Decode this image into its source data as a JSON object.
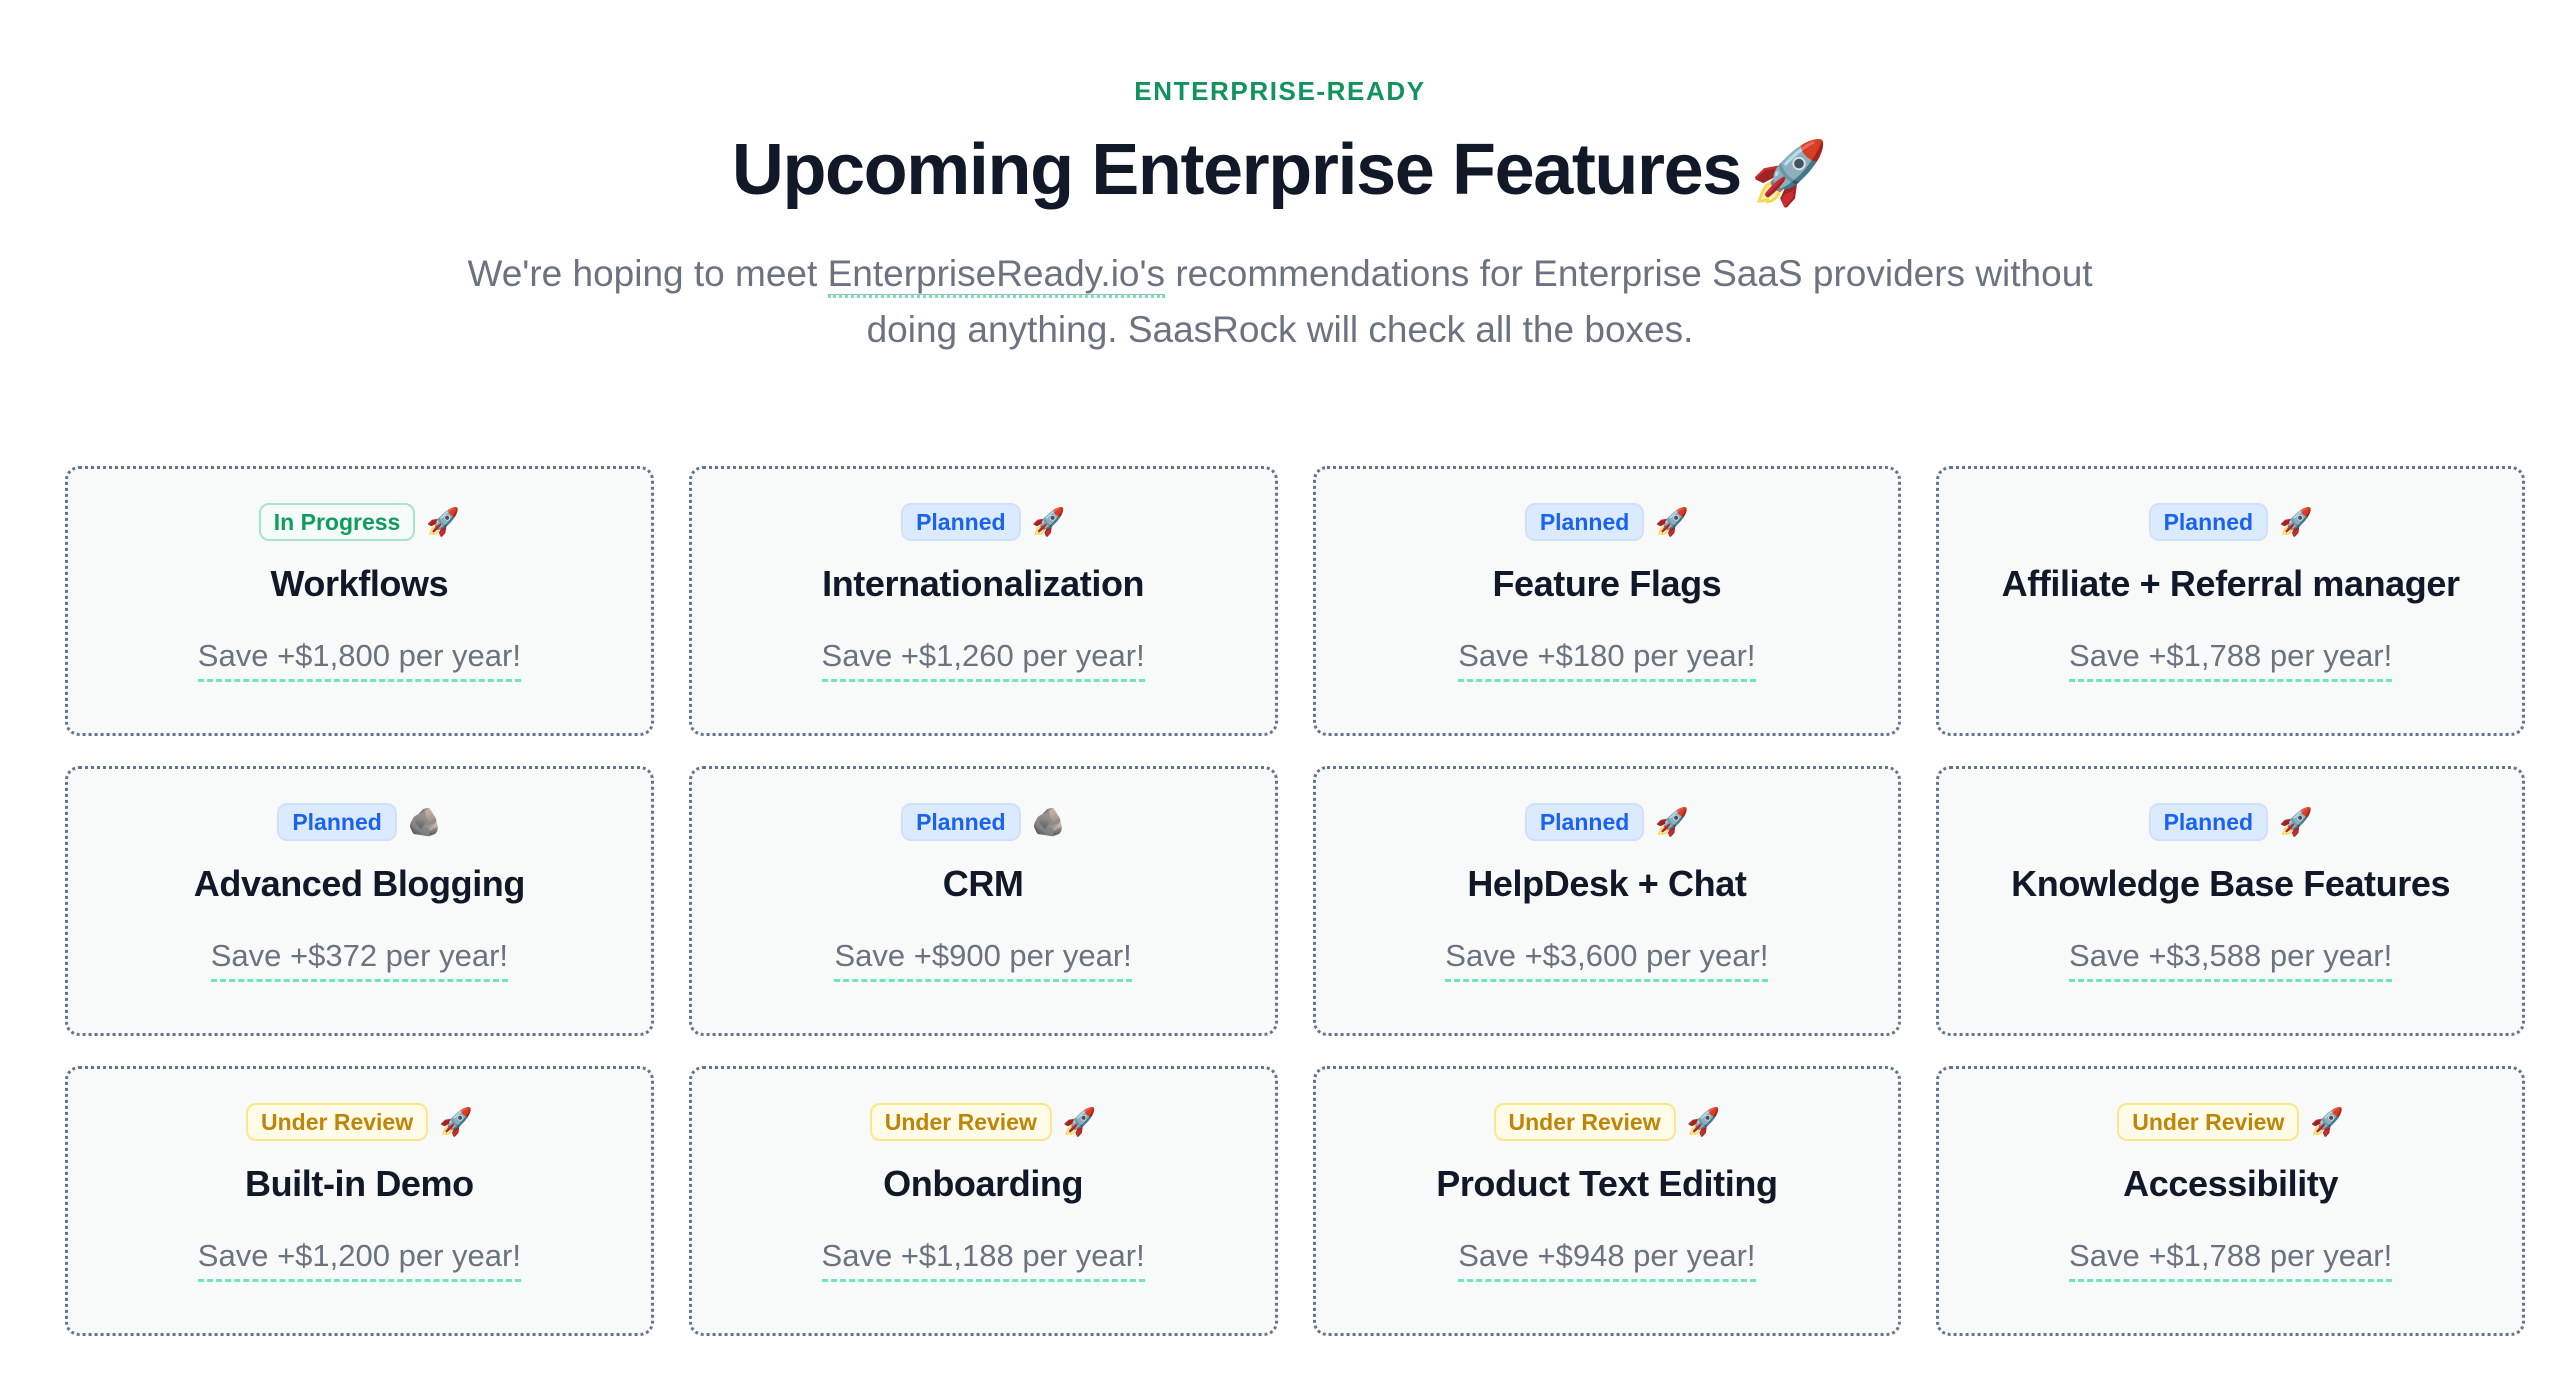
{
  "header": {
    "eyebrow": "ENTERPRISE-READY",
    "title": "Upcoming Enterprise Features",
    "title_emoji": "🚀",
    "subtitle_before": "We're hoping to meet ",
    "subtitle_link": "EnterpriseReady.io's",
    "subtitle_after": " recommendations for Enterprise SaaS providers without doing anything. SaasRock will check all the boxes."
  },
  "colors": {
    "accent_green": "#12935b",
    "badge_progress_text": "#109c5f",
    "badge_planned_text": "#1a62f2",
    "badge_review_text": "#c08406",
    "underline_green": "#6ee7b7",
    "card_bg": "#f8fafa",
    "card_border": "#64748b",
    "title": "#111827",
    "muted": "#6b7280"
  },
  "cards": [
    {
      "status": "In Progress",
      "status_key": "progress",
      "emoji": "🚀",
      "emoji_name": "rocket-icon",
      "title": "Workflows",
      "save": "Save +$1,800 per year!"
    },
    {
      "status": "Planned",
      "status_key": "planned",
      "emoji": "🚀",
      "emoji_name": "rocket-icon",
      "title": "Internationalization",
      "save": "Save +$1,260 per year!"
    },
    {
      "status": "Planned",
      "status_key": "planned",
      "emoji": "🚀",
      "emoji_name": "rocket-icon",
      "title": "Feature Flags",
      "save": "Save +$180 per year!"
    },
    {
      "status": "Planned",
      "status_key": "planned",
      "emoji": "🚀",
      "emoji_name": "rocket-icon",
      "title": "Affiliate + Referral manager",
      "save": "Save +$1,788 per year!"
    },
    {
      "status": "Planned",
      "status_key": "planned",
      "emoji": "🪨",
      "emoji_name": "rock-icon",
      "title": "Advanced Blogging",
      "save": "Save +$372 per year!"
    },
    {
      "status": "Planned",
      "status_key": "planned",
      "emoji": "🪨",
      "emoji_name": "rock-icon",
      "title": "CRM",
      "save": "Save +$900 per year!"
    },
    {
      "status": "Planned",
      "status_key": "planned",
      "emoji": "🚀",
      "emoji_name": "rocket-icon",
      "title": "HelpDesk + Chat",
      "save": "Save +$3,600 per year!"
    },
    {
      "status": "Planned",
      "status_key": "planned",
      "emoji": "🚀",
      "emoji_name": "rocket-icon",
      "title": "Knowledge Base Features",
      "save": "Save +$3,588 per year!"
    },
    {
      "status": "Under Review",
      "status_key": "review",
      "emoji": "🚀",
      "emoji_name": "rocket-icon",
      "title": "Built-in Demo",
      "save": "Save +$1,200 per year!"
    },
    {
      "status": "Under Review",
      "status_key": "review",
      "emoji": "🚀",
      "emoji_name": "rocket-icon",
      "title": "Onboarding",
      "save": "Save +$1,188 per year!"
    },
    {
      "status": "Under Review",
      "status_key": "review",
      "emoji": "🚀",
      "emoji_name": "rocket-icon",
      "title": "Product Text Editing",
      "save": "Save +$948 per year!"
    },
    {
      "status": "Under Review",
      "status_key": "review",
      "emoji": "🚀",
      "emoji_name": "rocket-icon",
      "title": "Accessibility",
      "save": "Save +$1,788 per year!"
    }
  ]
}
